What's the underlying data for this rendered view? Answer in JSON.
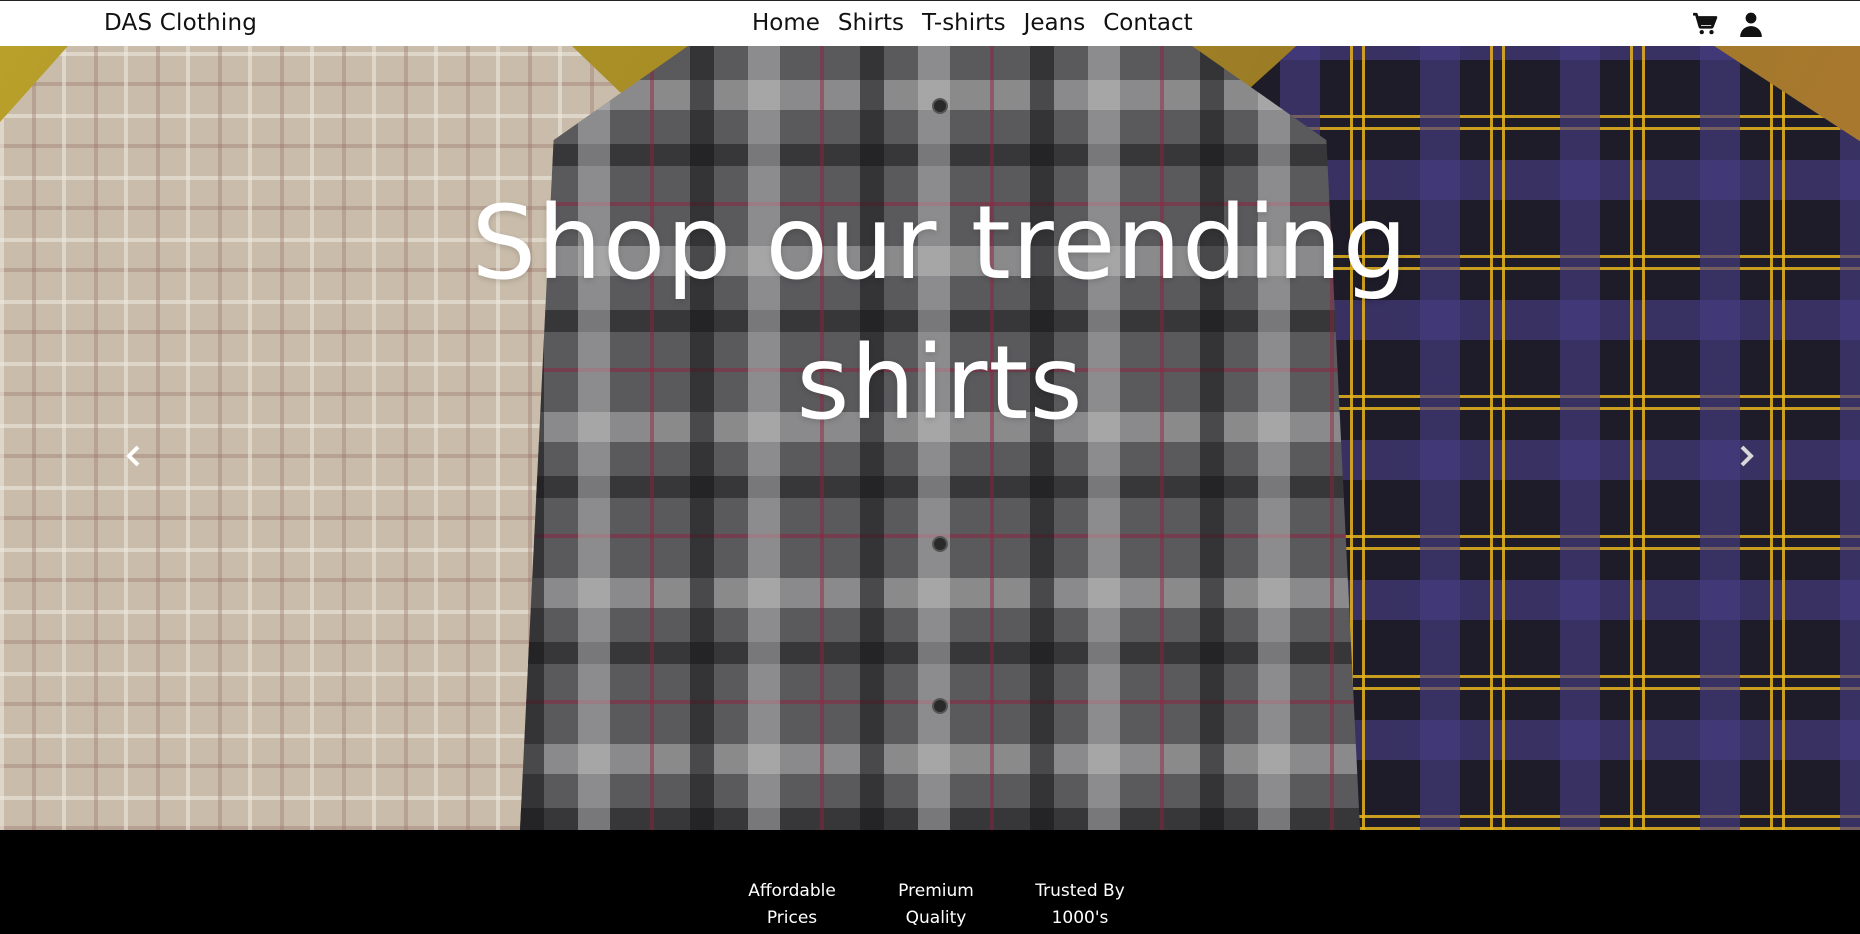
{
  "navbar": {
    "brand": "DAS Clothing",
    "links": [
      "Home",
      "Shirts",
      "T-shirts",
      "Jeans",
      "Contact"
    ],
    "icons": [
      "cart-icon",
      "user-icon"
    ]
  },
  "hero": {
    "title_line1": "Shop our trending",
    "title_line2": "shirts",
    "controls": {
      "prev_icon": "chevron-left-icon",
      "next_icon": "chevron-right-icon"
    },
    "slides_total": 3,
    "active_slide": 1
  },
  "features": [
    {
      "line1": "Affordable",
      "line2": "Prices"
    },
    {
      "line1": "Premium",
      "line2": "Quality"
    },
    {
      "line1": "Trusted By",
      "line2": "1000's"
    }
  ],
  "colors": {
    "navbar_bg": "#ffffff",
    "text_dark": "#111111",
    "hero_text": "#ffffff",
    "footer_bg": "#000000"
  }
}
